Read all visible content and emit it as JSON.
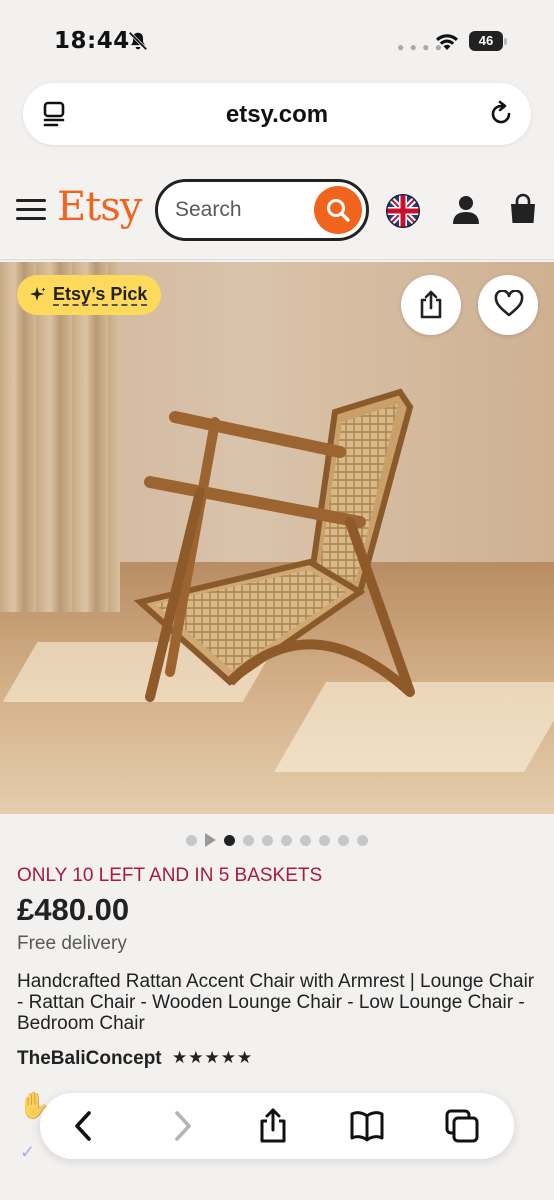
{
  "status_bar": {
    "time": "18:44",
    "battery": "46"
  },
  "browser": {
    "domain": "etsy.com"
  },
  "header": {
    "logo": "Etsy",
    "search_placeholder": "Search"
  },
  "hero": {
    "badge": "Etsy’s Pick",
    "slides_total": 9,
    "active_slide": 1
  },
  "product": {
    "stock_notice": "ONLY 10 LEFT AND IN 5 BASKETS",
    "price": "£480.00",
    "delivery": "Free delivery",
    "title": "Handcrafted Rattan Accent Chair with Armrest | Lounge Chair - Rattan Chair - Wooden Lounge Chair - Low Lounge Chair - Bedroom Chair",
    "seller": "TheBaliConcept",
    "rating_stars": "★★★★★",
    "rating_value": 5
  },
  "colors": {
    "brand": "#f1641e",
    "badge": "#fdd95c",
    "stock": "#a61a48"
  }
}
